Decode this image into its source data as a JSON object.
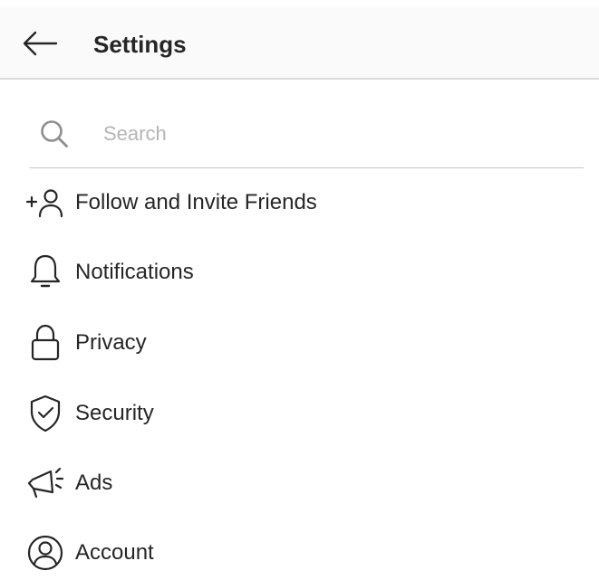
{
  "header": {
    "title": "Settings"
  },
  "search": {
    "placeholder": "Search"
  },
  "menu": [
    {
      "label": "Follow and Invite Friends",
      "icon": "add-person-icon"
    },
    {
      "label": "Notifications",
      "icon": "bell-icon"
    },
    {
      "label": "Privacy",
      "icon": "lock-icon"
    },
    {
      "label": "Security",
      "icon": "shield-check-icon"
    },
    {
      "label": "Ads",
      "icon": "megaphone-icon"
    },
    {
      "label": "Account",
      "icon": "account-circle-icon"
    }
  ],
  "colors": {
    "text": "#262626",
    "placeholder": "#b5b5b5",
    "header_bg": "#fafafa",
    "divider": "#dbdbdb"
  }
}
